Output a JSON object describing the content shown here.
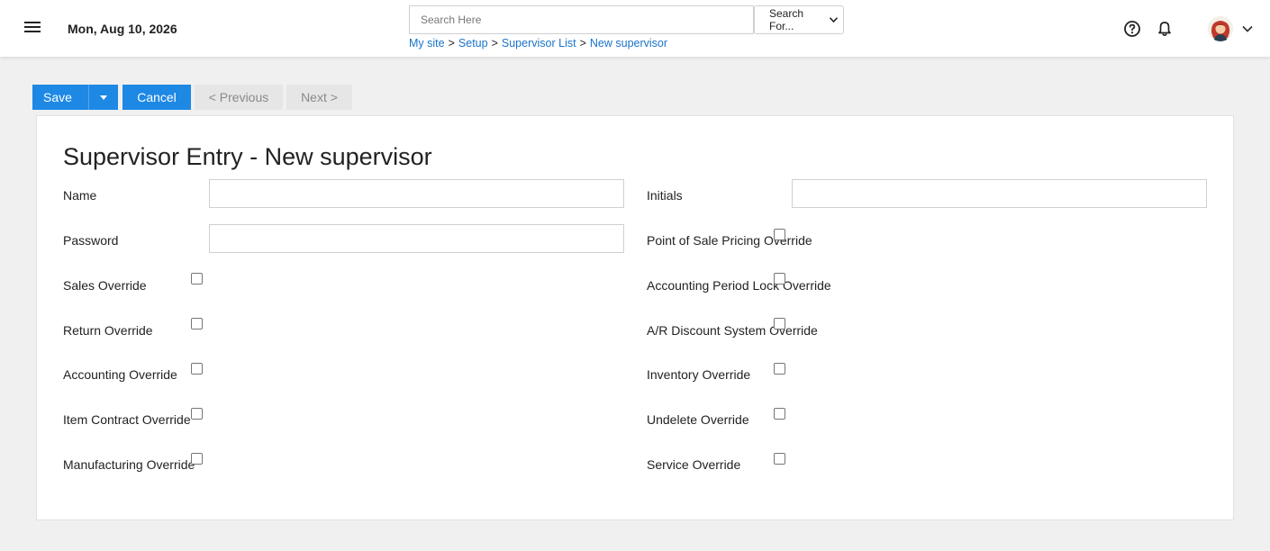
{
  "header": {
    "date": "Mon, Aug 10, 2026",
    "search_placeholder": "Search Here",
    "search_select": "Search For...",
    "breadcrumb": [
      "My site",
      "Setup",
      "Supervisor List",
      "New supervisor"
    ],
    "breadcrumb_separator": ">"
  },
  "toolbar": {
    "save_label": "Save",
    "cancel_label": "Cancel",
    "previous_label": "< Previous",
    "next_label": "Next >"
  },
  "form": {
    "title": "Supervisor Entry - New supervisor",
    "name_label": "Name",
    "password_label": "Password",
    "initials_label": "Initials",
    "left_checkboxes": [
      "Sales Override",
      "Return Override",
      "Accounting Override",
      "Item Contract Override",
      "Manufacturing Override"
    ],
    "right_checkboxes": [
      "Point of Sale Pricing Override",
      "Accounting Period Lock Override",
      "A/R Discount System Override",
      "Inventory Override",
      "Undelete Override",
      "Service Override"
    ]
  },
  "colors": {
    "accent": "#1e88e5",
    "link": "#1a73c8"
  }
}
